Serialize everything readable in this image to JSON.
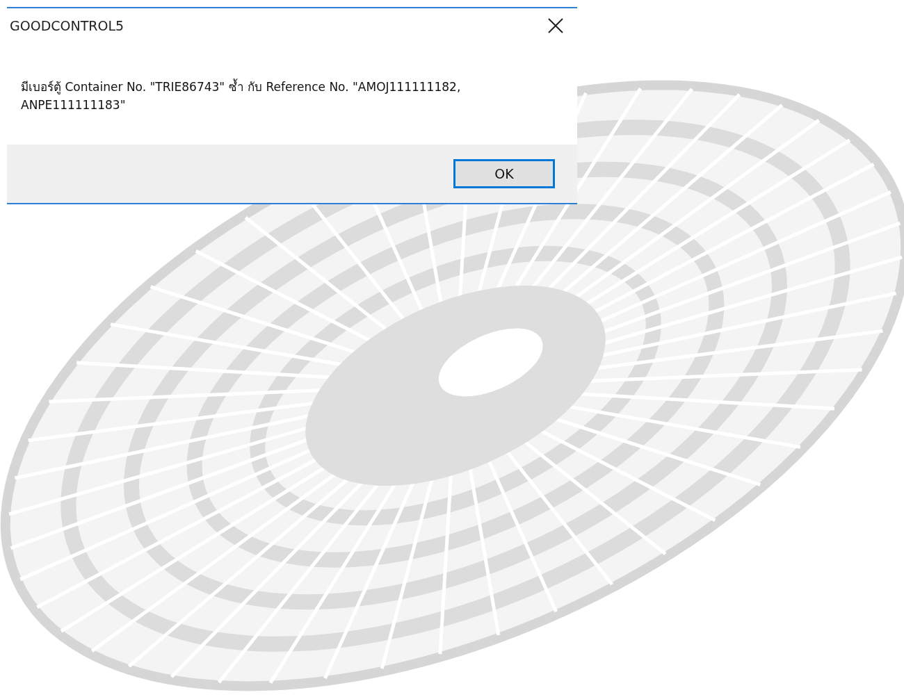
{
  "dialog": {
    "title": "GOODCONTROL5",
    "message": "มีเบอร์ตู้ Container No. \"TRIE86743\" ซ้ำ กับ Reference No. \"AMOJ111111182, ANPE111111183\"",
    "buttons": [
      {
        "label": "OK",
        "selected": true
      }
    ]
  }
}
